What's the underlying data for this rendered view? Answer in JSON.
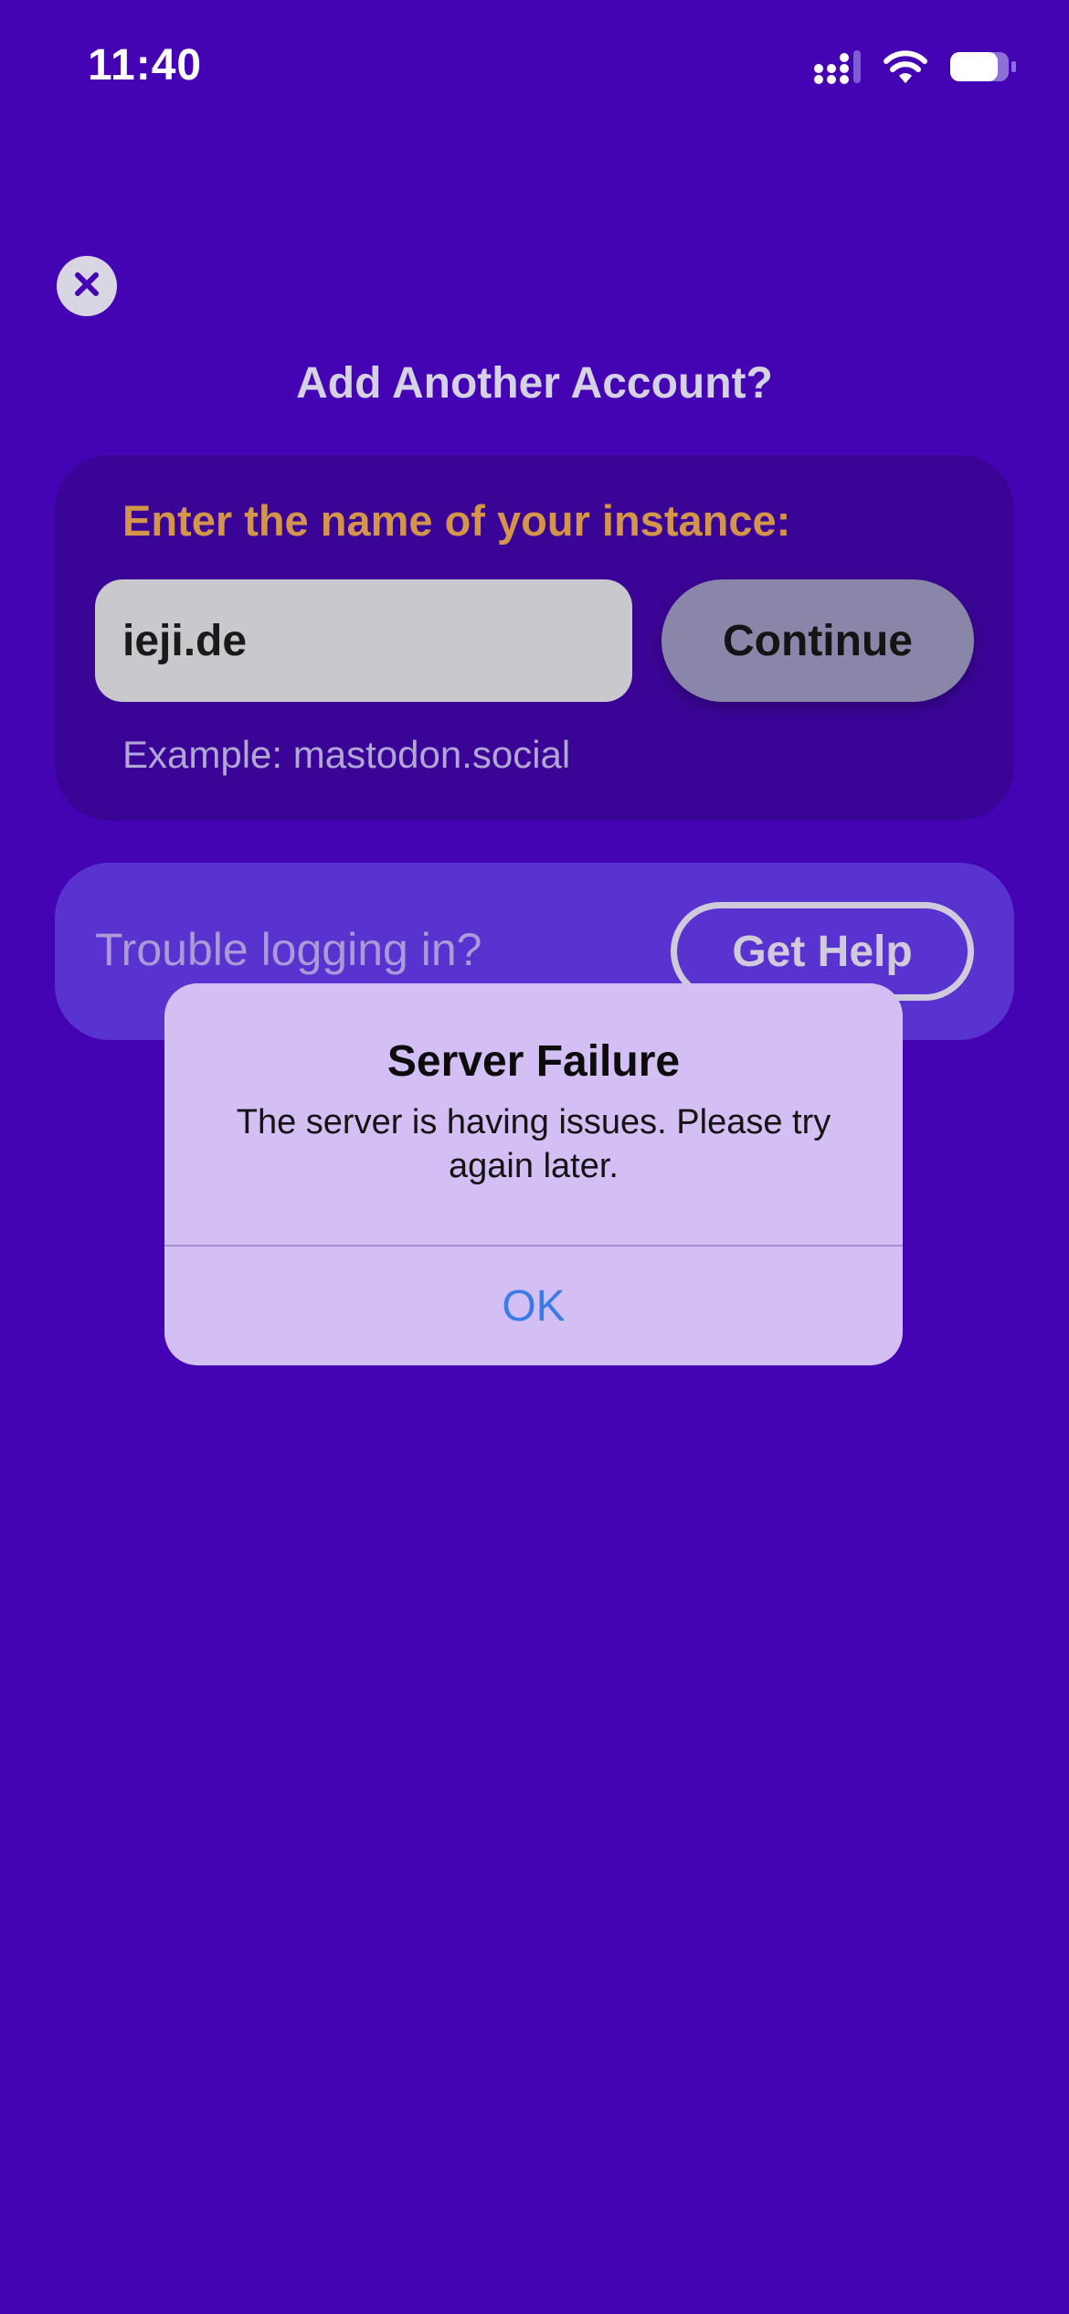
{
  "status_bar": {
    "time": "11:40",
    "icons": [
      "signal-icon",
      "wifi-icon",
      "battery-icon"
    ]
  },
  "screen": {
    "close_icon": "close-icon",
    "title": "Add Another Account?"
  },
  "instance": {
    "prompt": "Enter the name of your instance:",
    "input_value": "ieji.de",
    "continue_label": "Continue",
    "example": "Example: mastodon.social"
  },
  "help": {
    "text": "Trouble logging in?",
    "button_label": "Get Help"
  },
  "alert": {
    "title": "Server Failure",
    "message": "The server is having issues. Please try again later.",
    "ok_label": "OK"
  },
  "colors": {
    "background": "#4404b4",
    "card": "#3a0596",
    "help_card": "#5833cf",
    "accent_orange": "#d4954a",
    "alert_bg": "#d4bff5",
    "link_blue": "#3b7be8"
  }
}
